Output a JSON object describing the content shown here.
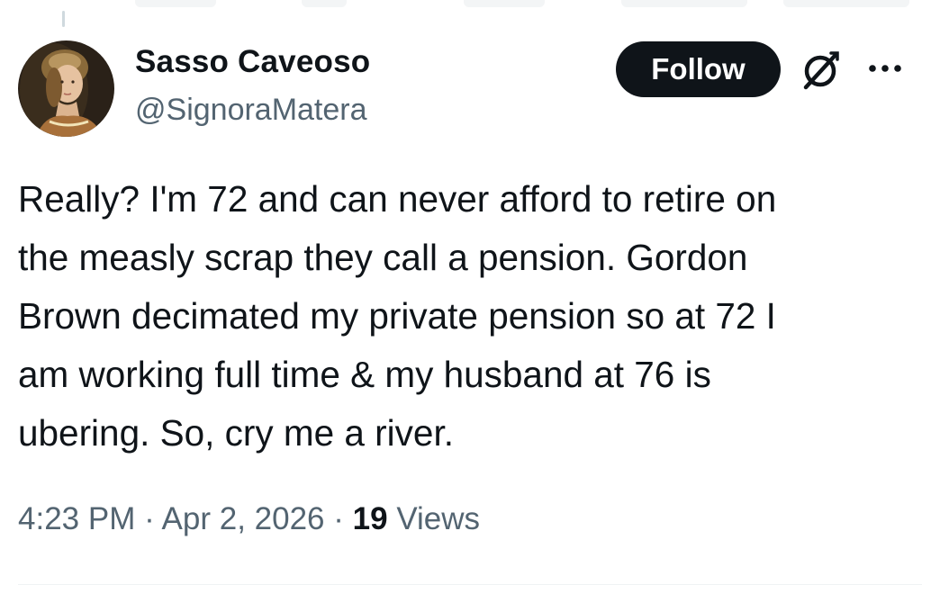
{
  "author": {
    "display_name": "Sasso Caveoso",
    "handle": "@SignoraMatera"
  },
  "actions": {
    "follow_label": "Follow",
    "grok_icon": "grok-icon",
    "more_icon": "more-icon"
  },
  "tweet": {
    "lines": [
      "Really? I'm 72 and can never afford to retire on",
      "the measly scrap they call a pension. Gordon",
      "Brown decimated my private pension so at 72 I",
      "am working full time & my husband at 76 is",
      "ubering. So, cry me a river."
    ]
  },
  "meta": {
    "time": "4:23 PM",
    "separator": "·",
    "date": "Apr 2, 2026",
    "views_count": "19",
    "views_label": "Views"
  },
  "colors": {
    "text_primary": "#0f1419",
    "text_secondary": "#536471",
    "follow_bg": "#0f1419",
    "divider": "#eff3f4"
  }
}
